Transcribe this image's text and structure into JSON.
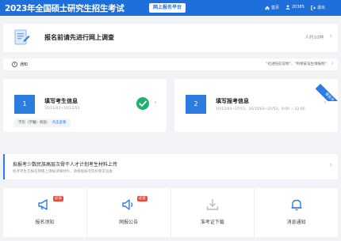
{
  "header": {
    "title": "2023年全国硕士研究生招生考试",
    "badge": "网上报名平台",
    "nav": [
      {
        "label": "首页",
        "icon": "home-icon"
      },
      {
        "label": "20385",
        "icon": "user-icon"
      },
      {
        "label": "退出",
        "icon": "logout-icon"
      }
    ]
  },
  "survey": {
    "text": "报名前请先进行网上调查",
    "count": "人约10种"
  },
  "notice": {
    "label": "通知",
    "text": "“社进陪前说明”，“利保安设生情报明”"
  },
  "steps": [
    {
      "number": "1",
      "title": "填写考生信息",
      "subtitle": "10/11/03~10/12/53",
      "foot_label": "学历（学籍）校验：",
      "foot_link": "点击查看",
      "completed": true
    },
    {
      "number": "2",
      "title": "填写报考信息",
      "subtitle": "10/12/03~27/53，10/15/03~25/53，9:00 ~ 22:00",
      "ribbon": "报名中"
    }
  ],
  "news": {
    "title": "拟报考少数民族高层次骨干人才计划考生材料上传",
    "subtitle": "拟考考生在报名网络上填报详细材料，请根据报考院校要求准备"
  },
  "quick_links": [
    {
      "label": "报名须知",
      "icon": "megaphone-icon",
      "badge": "必读"
    },
    {
      "label": "网报公告",
      "icon": "speaker-icon",
      "badge": "必读"
    },
    {
      "label": "准考证下载",
      "icon": "download-icon"
    },
    {
      "label": "消息通知",
      "icon": "bell-icon"
    }
  ],
  "colors": {
    "primary": "#1e6fd9",
    "accent": "#2d7de0",
    "success": "#1eb16d",
    "badge": "#e84b3c"
  }
}
